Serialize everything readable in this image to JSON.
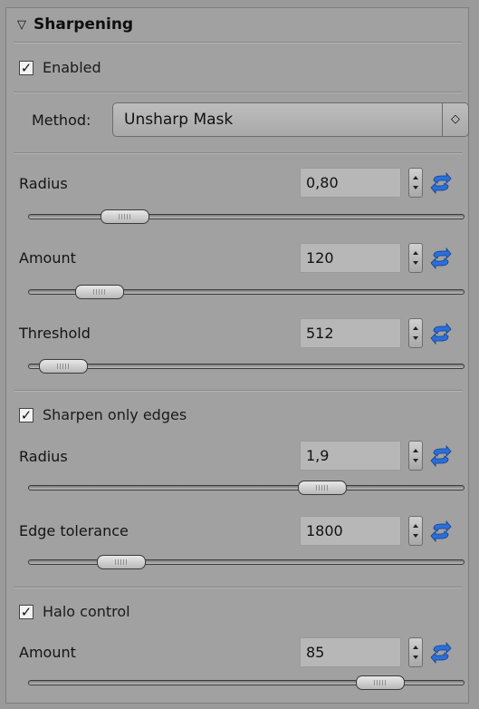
{
  "section": {
    "title": "Sharpening"
  },
  "enabled": {
    "label": "Enabled",
    "checked": true
  },
  "method": {
    "label": "Method:",
    "value": "Unsharp Mask"
  },
  "radius": {
    "label": "Radius",
    "value": "0,80",
    "level": 0.18
  },
  "amount": {
    "label": "Amount",
    "value": "120",
    "level": 0.12
  },
  "threshold": {
    "label": "Threshold",
    "value": "512",
    "level": 0.03
  },
  "sharpen_edges": {
    "label": "Sharpen only edges",
    "checked": true
  },
  "edge_radius": {
    "label": "Radius",
    "value": "1,9",
    "level": 0.69
  },
  "edge_tolerance": {
    "label": "Edge tolerance",
    "value": "1800",
    "level": 0.17
  },
  "halo": {
    "label": "Halo control",
    "checked": true
  },
  "halo_amount": {
    "label": "Amount",
    "value": "85",
    "level": 0.83
  },
  "colors": {
    "reset_icon": "#2a6fdb",
    "panel_bg": "#a1a1a1"
  }
}
